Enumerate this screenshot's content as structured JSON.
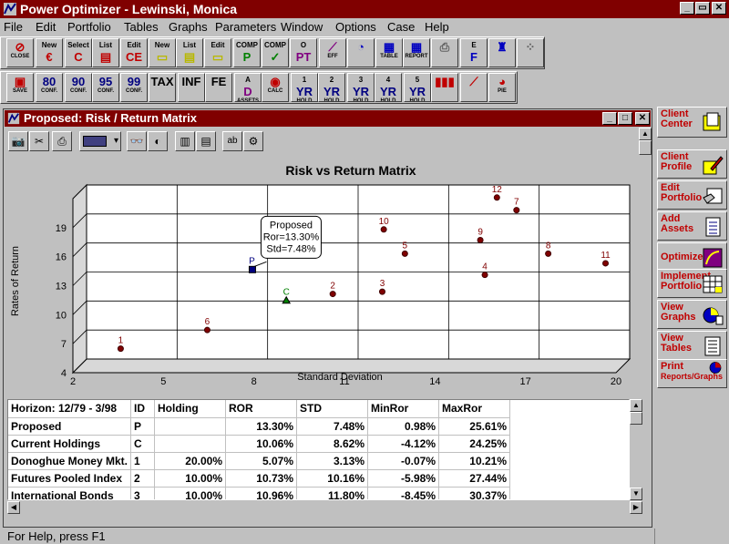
{
  "app": {
    "title": "Power Optimizer - Lewinski, Monica",
    "window_buttons": [
      "_",
      "▭",
      "✕"
    ]
  },
  "menu": [
    "File",
    "Edit",
    "Portfolio",
    "Tables",
    "Graphs",
    "Parameters",
    "Window",
    "Options",
    "Case",
    "Help"
  ],
  "toolbar1": [
    {
      "name": "close-button",
      "top": "",
      "glyph": "⊘",
      "sub": "CLOSE",
      "color": "#c00000"
    },
    {
      "name": "new-case-button",
      "top": "New",
      "glyph": "€",
      "sub": "",
      "color": "#c00000"
    },
    {
      "name": "select-case-button",
      "top": "Select",
      "glyph": "C",
      "sub": "",
      "color": "#c00000"
    },
    {
      "name": "list-case-button",
      "top": "List",
      "glyph": "▤",
      "sub": "",
      "color": "#c00000"
    },
    {
      "name": "edit-case-button",
      "top": "Edit",
      "glyph": "CE",
      "sub": "",
      "color": "#c00000"
    },
    {
      "name": "new-portfolio-button",
      "top": "New",
      "glyph": "▭",
      "sub": "",
      "color": "#b8b800"
    },
    {
      "name": "list-portfolio-button",
      "top": "List",
      "glyph": "▤",
      "sub": "",
      "color": "#b8b800"
    },
    {
      "name": "edit-portfolio-button",
      "top": "Edit",
      "glyph": "▭",
      "sub": "",
      "color": "#b8b800"
    },
    {
      "name": "comp-p-button",
      "top": "COMP",
      "glyph": "P",
      "sub": "",
      "color": "#008000"
    },
    {
      "name": "comp-check-button",
      "top": "COMP",
      "glyph": "✓",
      "sub": "",
      "color": "#008000"
    },
    {
      "name": "opt-button",
      "top": "O",
      "glyph": "PT",
      "sub": "",
      "color": "#800080"
    },
    {
      "name": "eff-button",
      "top": "",
      "glyph": "⟋",
      "sub": "EFF",
      "color": "#800080"
    },
    {
      "name": "graph-button",
      "top": "",
      "glyph": "◔",
      "sub": "",
      "color": "#0000c0"
    },
    {
      "name": "table-button",
      "top": "",
      "glyph": "▦",
      "sub": "TABLE",
      "color": "#0000c0"
    },
    {
      "name": "report-button",
      "top": "",
      "glyph": "▦",
      "sub": "REPORT",
      "color": "#0000c0"
    },
    {
      "name": "print-button",
      "top": "",
      "glyph": "⎙",
      "sub": "",
      "color": "#606060"
    },
    {
      "name": "ef-button",
      "top": "E",
      "glyph": "F",
      "sub": "",
      "color": "#0000c0"
    },
    {
      "name": "money-button",
      "top": "",
      "glyph": "♜",
      "sub": "",
      "color": "#0000c0"
    },
    {
      "name": "scatter-button",
      "top": "",
      "glyph": "⁘",
      "sub": "",
      "color": "#606060"
    }
  ],
  "toolbar2": [
    {
      "name": "save-button",
      "top": "",
      "glyph": "▣",
      "sub": "SAVE",
      "color": "#c00000"
    },
    {
      "name": "conf-80-button",
      "top": "",
      "glyph": "80",
      "sub": "CONF.",
      "color": "#000080"
    },
    {
      "name": "conf-90-button",
      "top": "",
      "glyph": "90",
      "sub": "CONF.",
      "color": "#000080"
    },
    {
      "name": "conf-95-button",
      "top": "",
      "glyph": "95",
      "sub": "CONF.",
      "color": "#000080"
    },
    {
      "name": "conf-99-button",
      "top": "",
      "glyph": "99",
      "sub": "CONF.",
      "color": "#000080"
    },
    {
      "name": "tax-button",
      "top": "",
      "glyph": "TAX",
      "sub": "",
      "color": "#000000"
    },
    {
      "name": "inf-button",
      "top": "",
      "glyph": "INF",
      "sub": "",
      "color": "#000000"
    },
    {
      "name": "fee-button",
      "top": "",
      "glyph": "FE",
      "sub": "",
      "color": "#000000"
    },
    {
      "name": "assets-button",
      "top": "A",
      "glyph": "D",
      "sub": "ASSETS",
      "color": "#800080"
    },
    {
      "name": "calc-button",
      "top": "",
      "glyph": "◉",
      "sub": "CALC",
      "color": "#c00000"
    },
    {
      "name": "hold-1yr-button",
      "top": "1",
      "glyph": "YR",
      "sub": "HOLD",
      "color": "#000080"
    },
    {
      "name": "hold-2yr-button",
      "top": "2",
      "glyph": "YR",
      "sub": "HOLD",
      "color": "#000080"
    },
    {
      "name": "hold-3yr-button",
      "top": "3",
      "glyph": "YR",
      "sub": "HOLD",
      "color": "#000080"
    },
    {
      "name": "hold-4yr-button",
      "top": "4",
      "glyph": "YR",
      "sub": "HOLD",
      "color": "#000080"
    },
    {
      "name": "hold-5yr-button",
      "top": "5",
      "glyph": "YR",
      "sub": "HOLD",
      "color": "#000080"
    },
    {
      "name": "bar-chart-button",
      "top": "",
      "glyph": "▮▮▮",
      "sub": "",
      "color": "#c00000"
    },
    {
      "name": "line-chart-button",
      "top": "",
      "glyph": "⟋",
      "sub": "",
      "color": "#c00000"
    },
    {
      "name": "pie-chart-button",
      "top": "",
      "glyph": "◕",
      "sub": "PIE",
      "color": "#c00000"
    }
  ],
  "child_window": {
    "title": "Proposed: Risk / Return Matrix"
  },
  "chart_tools": [
    "📷",
    "✂",
    "⎙",
    "",
    "▾",
    "👓",
    "◐",
    "▥",
    "▤",
    "ab",
    "⚙"
  ],
  "chart_data": {
    "type": "scatter",
    "title": "Risk vs Return Matrix",
    "xlabel": "Standard Deviation",
    "ylabel": "Rates of Return",
    "xlim": [
      2,
      20
    ],
    "ylim": [
      4,
      22
    ],
    "x_ticks": [
      2,
      5,
      8,
      11,
      14,
      17,
      20
    ],
    "y_ticks": [
      4,
      7,
      10,
      13,
      16,
      19
    ],
    "grid": true,
    "points": [
      {
        "label": "1",
        "x": 3.13,
        "y": 5.07
      },
      {
        "label": "6",
        "x": 6.0,
        "y": 7.0
      },
      {
        "label": "C",
        "x": 8.62,
        "y": 10.06
      },
      {
        "label": "P",
        "x": 7.48,
        "y": 13.3
      },
      {
        "label": "2",
        "x": 10.16,
        "y": 10.73
      },
      {
        "label": "3",
        "x": 11.8,
        "y": 10.96
      },
      {
        "label": "10",
        "x": 11.85,
        "y": 17.4
      },
      {
        "label": "5",
        "x": 12.55,
        "y": 14.9
      },
      {
        "label": "12",
        "x": 15.6,
        "y": 20.7
      },
      {
        "label": "7",
        "x": 16.25,
        "y": 19.4
      },
      {
        "label": "9",
        "x": 15.05,
        "y": 16.3
      },
      {
        "label": "4",
        "x": 15.2,
        "y": 12.7
      },
      {
        "label": "8",
        "x": 17.3,
        "y": 14.9
      },
      {
        "label": "11",
        "x": 19.2,
        "y": 13.9
      }
    ],
    "tooltip": [
      "Proposed",
      "Ror=13.30%",
      "Std=7.48%"
    ]
  },
  "table": {
    "headers": [
      "Horizon: 12/79 - 3/98",
      "ID",
      "Holding",
      "ROR",
      "STD",
      "MinRor",
      "MaxRor"
    ],
    "rows": [
      [
        "Proposed",
        "P",
        "",
        "13.30%",
        "7.48%",
        "0.98%",
        "25.61%"
      ],
      [
        "Current Holdings",
        "C",
        "",
        "10.06%",
        "8.62%",
        "-4.12%",
        "24.25%"
      ],
      [
        "Donoghue Money Mkt.",
        "1",
        "20.00%",
        "5.07%",
        "3.13%",
        "-0.07%",
        "10.21%"
      ],
      [
        "Futures Pooled Index",
        "2",
        "10.00%",
        "10.73%",
        "10.16%",
        "-5.98%",
        "27.44%"
      ],
      [
        "International Bonds",
        "3",
        "10.00%",
        "10.96%",
        "11.80%",
        "-8.45%",
        "30.37%"
      ]
    ]
  },
  "sidebar": [
    {
      "name": "client-center-button",
      "line1": "Client",
      "line2": "Center",
      "icon": "folder-icon"
    },
    {
      "name": "client-profile-button",
      "line1": "Client",
      "line2": "Profile",
      "icon": "pencil-icon"
    },
    {
      "name": "edit-portfolio-side-button",
      "line1": "Edit",
      "line2": "Portfolio",
      "icon": "hand-icon"
    },
    {
      "name": "add-assets-button",
      "line1": "Add",
      "line2": "Assets",
      "icon": "list-icon"
    },
    {
      "name": "optimize-button",
      "line1": "Optimize",
      "line2": "",
      "icon": "curve-icon"
    },
    {
      "name": "implement-portfolio-button",
      "line1": "Implement",
      "line2": "Portfolio",
      "icon": "grid-icon"
    },
    {
      "name": "view-graphs-button",
      "line1": "View",
      "line2": "Graphs",
      "icon": "pie-icon"
    },
    {
      "name": "view-tables-button",
      "line1": "View",
      "line2": "Tables",
      "icon": "table-icon"
    },
    {
      "name": "print-reports-button",
      "line1": "Print",
      "line2": "Reports/Graphs",
      "icon": "print-icon"
    }
  ],
  "status": "For Help, press F1"
}
